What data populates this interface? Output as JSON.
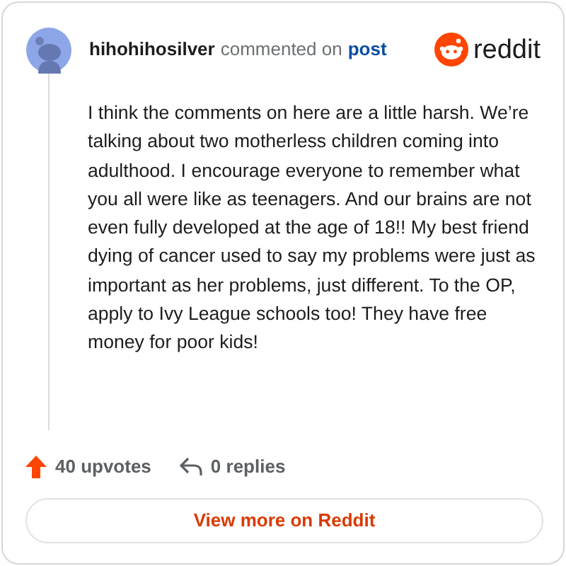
{
  "header": {
    "username": "hihohihosilver",
    "action": "commented on",
    "link": "post",
    "logo_text": "reddit"
  },
  "comment": {
    "body": "I think the comments on here are a little harsh. We’re talking about two motherless children coming into adulthood. I encourage everyone to remember what you all were like as teenagers. And our brains are not even fully developed at the age of 18!! My best friend dying of cancer used to say my problems were just as important as her problems, just different. To the OP, apply to Ivy League schools too! They have free money for poor kids!"
  },
  "stats": {
    "upvotes": "40 upvotes",
    "replies": "0 replies"
  },
  "button": "View more on Reddit"
}
